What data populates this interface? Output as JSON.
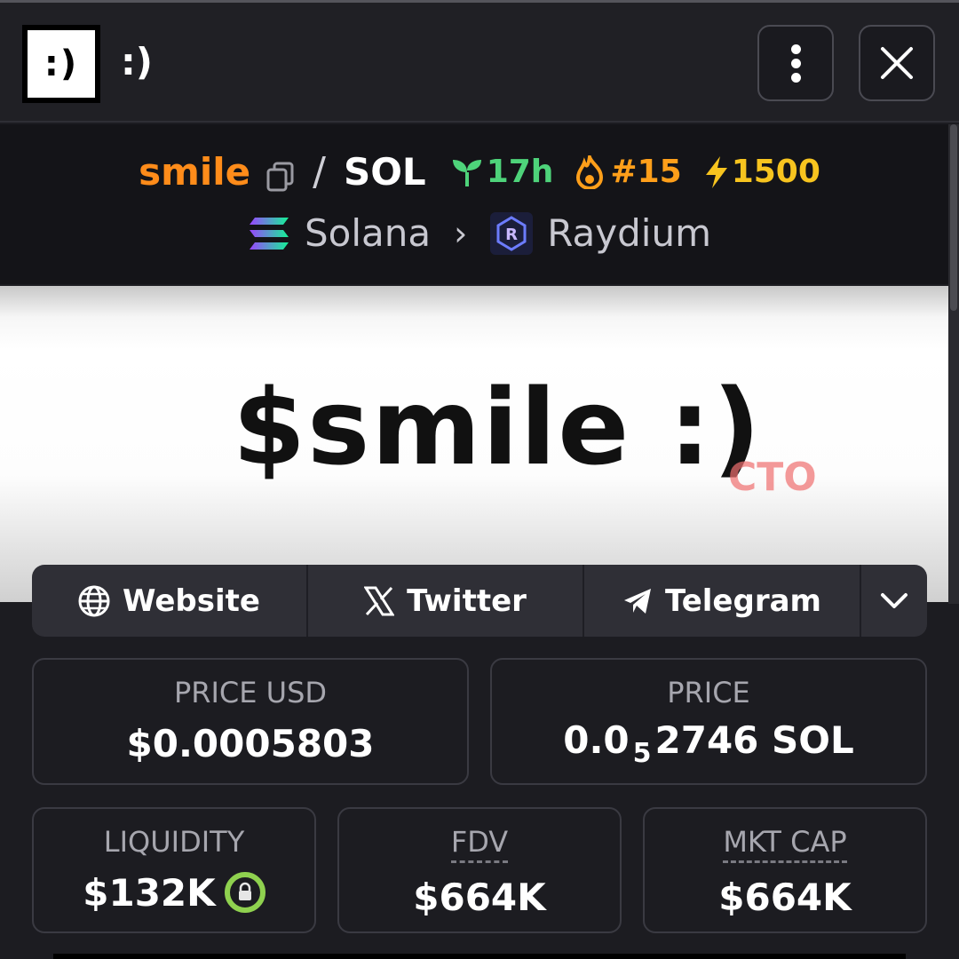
{
  "app": {
    "logo_text": ":)",
    "title": ":)"
  },
  "pair": {
    "base": "smile",
    "separator": "/",
    "quote": "SOL",
    "age": "17h",
    "trending_rank": "#15",
    "boosts": "1500"
  },
  "chain": {
    "network": "Solana",
    "dex": "Raydium"
  },
  "banner": {
    "text": "$smile :)",
    "tag": "CTO"
  },
  "links": {
    "website": "Website",
    "twitter": "Twitter",
    "telegram": "Telegram"
  },
  "stats": {
    "price_usd": {
      "label": "PRICE USD",
      "value": "$0.0005803"
    },
    "price_native": {
      "label": "PRICE",
      "prefix": "0.0",
      "subscript_zeros": "5",
      "digits": "2746",
      "unit": "SOL"
    },
    "liquidity": {
      "label": "LIQUIDITY",
      "value": "$132K"
    },
    "fdv": {
      "label": "FDV",
      "value": "$664K"
    },
    "mkt_cap": {
      "label": "MKT CAP",
      "value": "$664K"
    }
  },
  "colors": {
    "base_token": "#ff8c1a",
    "age": "#4ed37a",
    "trending": "#ff9f1a",
    "boost": "#f7c41f",
    "lock_ring": "#8fd14f"
  }
}
